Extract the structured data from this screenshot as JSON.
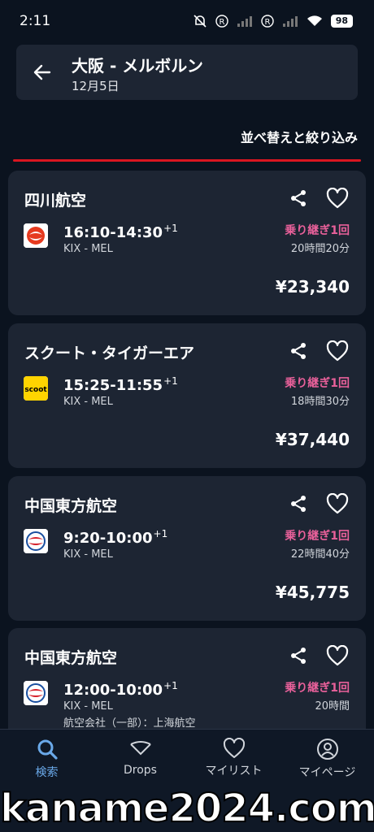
{
  "status_bar": {
    "time": "2:11",
    "battery": "98"
  },
  "header": {
    "route": "大阪 - メルボルン",
    "date": "12月5日"
  },
  "sort_filter_label": "並べ替えと絞り込み",
  "flights": [
    {
      "airline": "四川航空",
      "logo": "sichuan-airlines-logo",
      "times": "16:10-14:30",
      "day_offset": "+1",
      "airports": "KIX - MEL",
      "operated_by": "",
      "stops": "乗り継ぎ1回",
      "duration": "20時間20分",
      "price": "¥23,340"
    },
    {
      "airline": "スクート・タイガーエア",
      "logo": "scoot-logo",
      "logo_text": "scoot",
      "times": "15:25-11:55",
      "day_offset": "+1",
      "airports": "KIX - MEL",
      "operated_by": "",
      "stops": "乗り継ぎ1回",
      "duration": "18時間30分",
      "price": "¥37,440"
    },
    {
      "airline": "中国東方航空",
      "logo": "china-eastern-logo",
      "times": "9:20-10:00",
      "day_offset": "+1",
      "airports": "KIX - MEL",
      "operated_by": "",
      "stops": "乗り継ぎ1回",
      "duration": "22時間40分",
      "price": "¥45,775"
    },
    {
      "airline": "中国東方航空",
      "logo": "china-eastern-logo",
      "times": "12:00-10:00",
      "day_offset": "+1",
      "airports": "KIX - MEL",
      "operated_by": "航空会社（一部）：上海航空",
      "stops": "乗り継ぎ1回",
      "duration": "20時間",
      "price": ""
    }
  ],
  "nav": [
    {
      "label": "検索",
      "icon": "search-icon",
      "active": true
    },
    {
      "label": "Drops",
      "icon": "drops-icon",
      "active": false
    },
    {
      "label": "マイリスト",
      "icon": "heart-icon",
      "active": false
    },
    {
      "label": "マイページ",
      "icon": "profile-icon",
      "active": false
    }
  ],
  "watermark": "kaname2024.com",
  "colors": {
    "background": "#0b131f",
    "card": "#1d2533",
    "accent_red": "#d91620",
    "stops_pink": "#e8609a",
    "active_blue": "#6aa9e9"
  }
}
